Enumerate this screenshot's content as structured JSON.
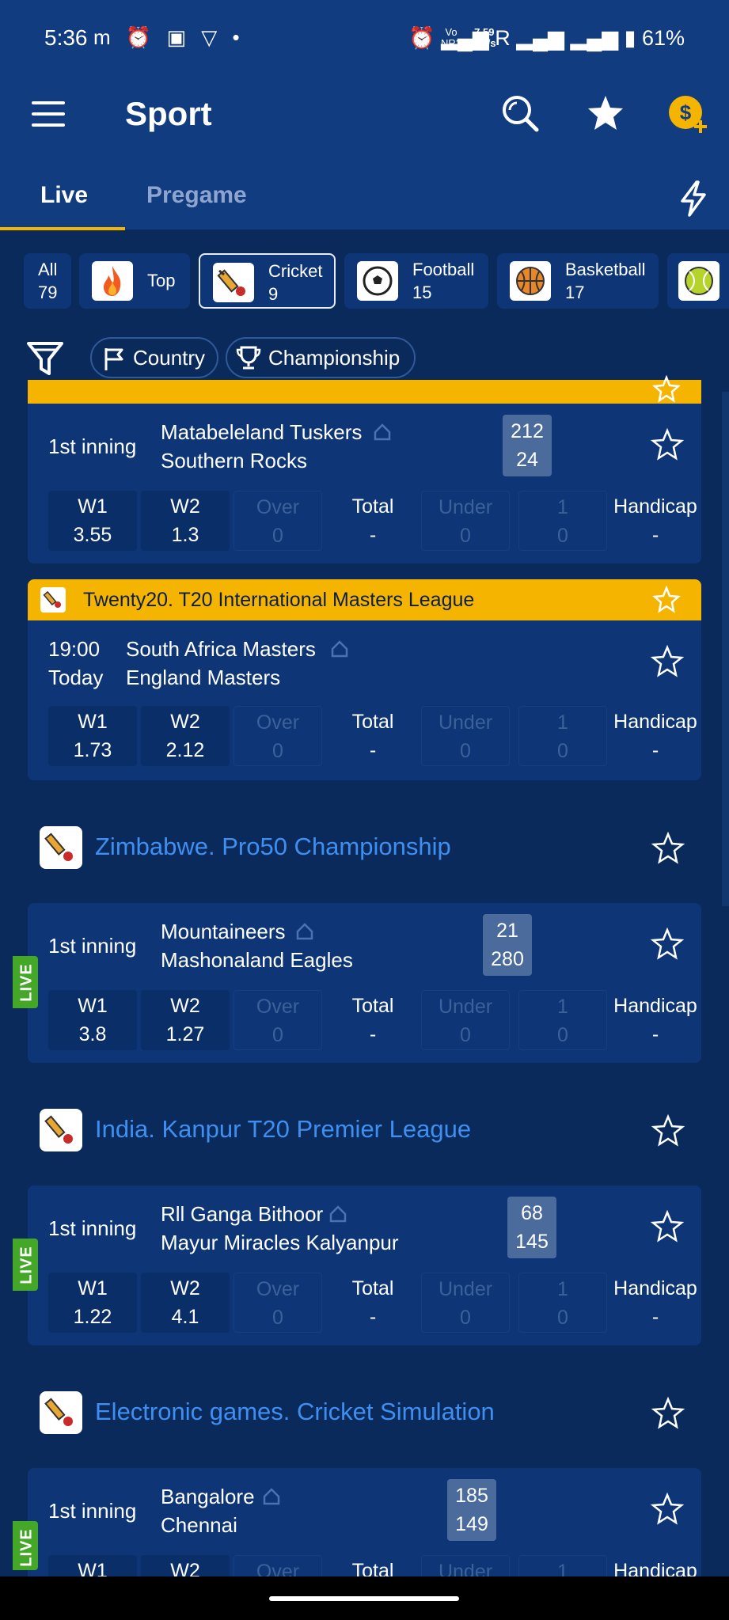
{
  "status_bar": {
    "time": "5:36",
    "left_icons": "m ⏰ ▣ ▽ •",
    "network_top": "Vo",
    "network_bottom": "NR2",
    "speed_top": "7.59",
    "speed_bottom": "KB/s",
    "right_text": "⏰          ▂▄▆ R ▂▄▆ ▂▄▆ ▮ 61%"
  },
  "header": {
    "title": "Sport",
    "icons": [
      "menu-icon",
      "search-icon",
      "star-icon",
      "coin-plus-icon"
    ]
  },
  "tabs": [
    {
      "label": "Live",
      "active": true
    },
    {
      "label": "Pregame",
      "active": false
    }
  ],
  "sports": [
    {
      "label": "All",
      "count": "79"
    },
    {
      "label": "Top",
      "count": ""
    },
    {
      "label": "Cricket",
      "count": "9",
      "selected": true
    },
    {
      "label": "Football",
      "count": "15"
    },
    {
      "label": "Basketball",
      "count": "17"
    }
  ],
  "filters": {
    "country": "Country",
    "championship": "Championship"
  },
  "odds_labels": {
    "w1": "W1",
    "w2": "W2",
    "over": "Over",
    "total": "Total",
    "under": "Under",
    "one": "1",
    "handicap": "Handicap",
    "dash": "-",
    "zero": "0"
  },
  "matches": [
    {
      "period": "1st inning",
      "team1": "Matabeleland Tuskers",
      "team2": "Southern Rocks",
      "score1": "212",
      "score2": "24",
      "w1": "3.55",
      "w2": "1.3"
    },
    {
      "league": "Twenty20. T20 International Masters League",
      "period": "19:00",
      "period2": "Today",
      "team1": "South Africa Masters",
      "team2": "England Masters",
      "w1": "1.73",
      "w2": "2.12"
    },
    {
      "league": "Zimbabwe. Pro50 Championship",
      "live": "LIVE",
      "period": "1st inning",
      "team1": "Mountaineers",
      "team2": "Mashonaland Eagles",
      "score1": "21",
      "score2": "280",
      "w1": "3.8",
      "w2": "1.27"
    },
    {
      "league": "India. Kanpur T20 Premier League",
      "live": "LIVE",
      "period": "1st inning",
      "team1": "Rll Ganga Bithoor",
      "team2": "Mayur Miracles Kalyanpur",
      "score1": "68",
      "score2": "145",
      "w1": "1.22",
      "w2": "4.1"
    },
    {
      "league": "Electronic games. Cricket Simulation",
      "live": "LIVE",
      "period": "1st inning",
      "team1": "Bangalore",
      "team2": "Chennai",
      "score1": "185",
      "score2": "149"
    }
  ],
  "colors": {
    "background": "#0b2a5c",
    "card": "#0e3677",
    "accent": "#f5b400",
    "league_link": "#3f8ff0",
    "live": "#44a728"
  }
}
